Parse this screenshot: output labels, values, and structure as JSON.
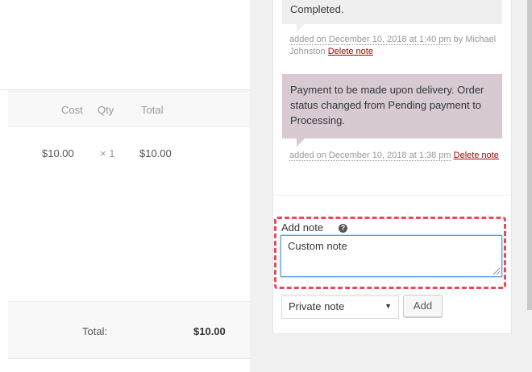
{
  "items": {
    "columns": {
      "cost": "Cost",
      "qty": "Qty",
      "total": "Total"
    },
    "row": {
      "cost": "$10.00",
      "qty": "× 1",
      "total": "$10.00"
    }
  },
  "totals": {
    "label": "Total:",
    "amount": "$10.00"
  },
  "notes": [
    {
      "text": "Completed.",
      "meta_date": "added on December 10, 2018 at 1:40 pm",
      "meta_by": " by Michael Johnston ",
      "delete": "Delete note"
    },
    {
      "text": "Payment to be made upon delivery. Order status changed from Pending payment to Processing.",
      "meta_date": "added on December 10, 2018 at 1:38 pm",
      "delete": "Delete note"
    }
  ],
  "add_note": {
    "label": "Add note",
    "help_icon": "?",
    "value": "Custom note",
    "type_selected": "Private note",
    "add_button": "Add"
  },
  "colors": {
    "highlight": "#e84a5a",
    "customer_note_bg": "#d7cad2",
    "delete_link": "#aa0000"
  }
}
